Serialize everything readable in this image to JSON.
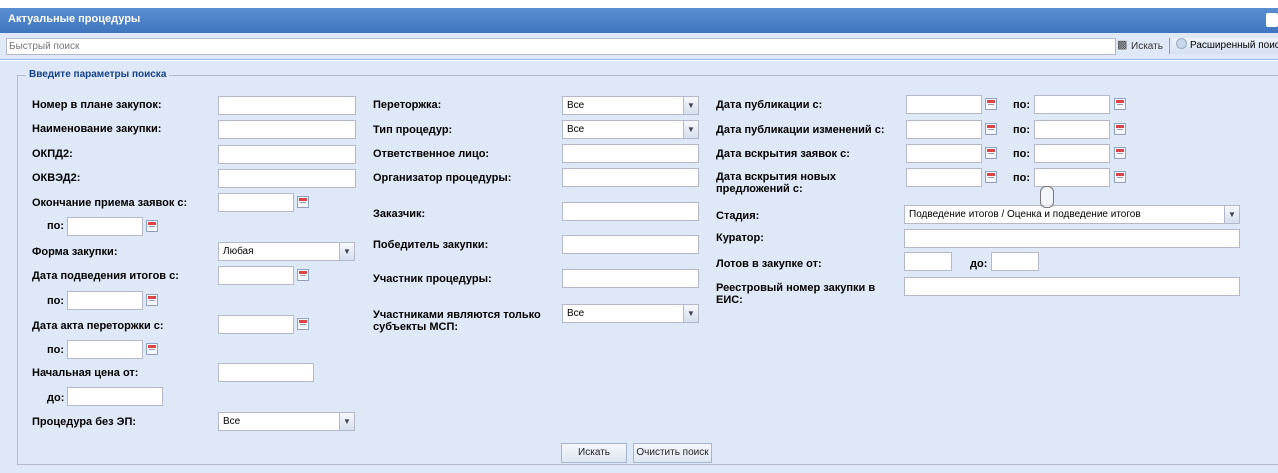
{
  "window": {
    "title": "Актуальные процедуры"
  },
  "quick_search": {
    "placeholder": "Быстрый поиск",
    "search_label": "Искать",
    "advanced_label": "Расширенный поиск"
  },
  "form": {
    "legend": "Введите параметры поиска",
    "col1": {
      "plan_number": "Номер в плане закупок:",
      "purchase_name": "Наименование закупки:",
      "okpd2": "ОКПД2:",
      "okved2": "ОКВЭД2:",
      "end_of_applications": "Окончание приема заявок с:",
      "to": "по:",
      "purchase_form": "Форма закупки:",
      "purchase_form_value": "Любая",
      "summary_date": "Дата подведения итогов с:",
      "rebid_act_date": "Дата акта переторжки с:",
      "start_price": "Начальная цена от:",
      "price_to": "до:",
      "no_signature": "Процедура без ЭП:",
      "no_signature_value": "Все"
    },
    "col2": {
      "rebid": "Переторжка:",
      "rebid_value": "Все",
      "procedure_type": "Тип процедур:",
      "procedure_type_value": "Все",
      "responsible": "Ответственное лицо:",
      "organizer": "Организатор процедуры:",
      "customer": "Заказчик:",
      "winner": "Победитель закупки:",
      "participant": "Участник процедуры:",
      "smb_only": "Участниками являются только субъекты МСП:",
      "smb_only_value": "Все"
    },
    "col3": {
      "publication_date": "Дата публикации с:",
      "changes_date": "Дата публикации изменений с:",
      "opening_date": "Дата вскрытия заявок с:",
      "new_offers_date": "Дата вскрытия новых предложений с:",
      "to": "по:",
      "stage": "Стадия:",
      "stage_value": "Подведение итогов / Оценка и подведение итогов",
      "curator": "Куратор:",
      "lots_from": "Лотов в закупке от:",
      "lots_to": "до:",
      "registry_number": "Реестровый номер закупки в ЕИС:"
    },
    "buttons": {
      "search": "Искать",
      "clear": "Очистить поиск"
    }
  }
}
